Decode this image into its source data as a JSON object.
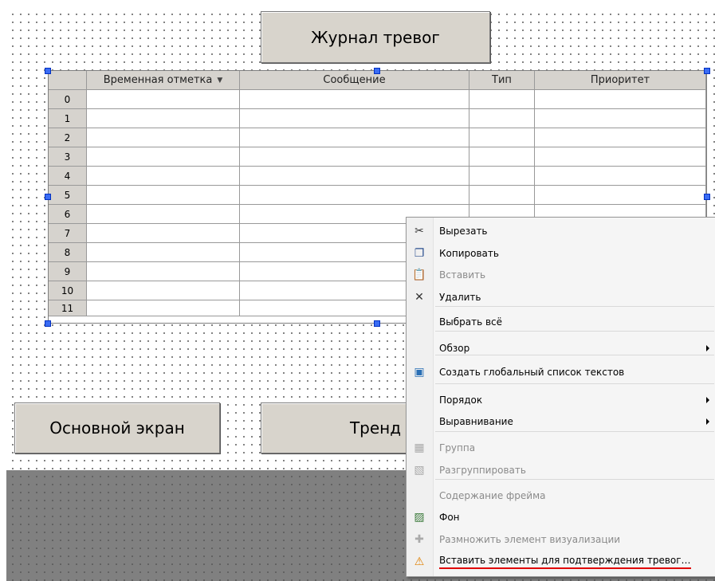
{
  "screen": {
    "title_button": "Журнал тревог",
    "main_screen_button": "Основной экран",
    "trend_button": "Тренд"
  },
  "alarm_table": {
    "columns": [
      "Временная отметка",
      "Сообщение",
      "Тип",
      "Приоритет"
    ],
    "sort_indicator": "▼",
    "rows": [
      "0",
      "1",
      "2",
      "3",
      "4",
      "5",
      "6",
      "7",
      "8",
      "9",
      "10",
      "11"
    ]
  },
  "context_menu": {
    "items": [
      {
        "label": "Вырезать",
        "icon": "scissors-icon",
        "disabled": false
      },
      {
        "label": "Копировать",
        "icon": "copy-icon",
        "disabled": false
      },
      {
        "label": "Вставить",
        "icon": "paste-icon",
        "disabled": true
      },
      {
        "label": "Удалить",
        "icon": "delete-icon",
        "disabled": false
      },
      {
        "label": "Выбрать всё",
        "icon": "",
        "disabled": false
      },
      {
        "label": "Обзор",
        "icon": "",
        "disabled": false,
        "submenu": true
      },
      {
        "label": "Создать глобальный список текстов",
        "icon": "text-list-icon",
        "disabled": false
      },
      {
        "label": "Порядок",
        "icon": "",
        "disabled": false,
        "submenu": true
      },
      {
        "label": "Выравнивание",
        "icon": "",
        "disabled": false,
        "submenu": true
      },
      {
        "label": "Группа",
        "icon": "group-icon",
        "disabled": true
      },
      {
        "label": "Разгруппировать",
        "icon": "ungroup-icon",
        "disabled": true
      },
      {
        "label": "Содержание фрейма",
        "icon": "",
        "disabled": true
      },
      {
        "label": "Фон",
        "icon": "background-icon",
        "disabled": false
      },
      {
        "label": "Размножить элемент визуализации",
        "icon": "multiply-element-icon",
        "disabled": true
      },
      {
        "label": "Вставить элементы для подтверждения тревог…",
        "icon": "warning-icon",
        "disabled": false,
        "highlighted": true
      }
    ]
  },
  "colors": {
    "button_face": "#d8d4cc",
    "selection_handle": "#3a6cf4",
    "highlight_underline": "#e00000",
    "background_gray": "#808080"
  }
}
